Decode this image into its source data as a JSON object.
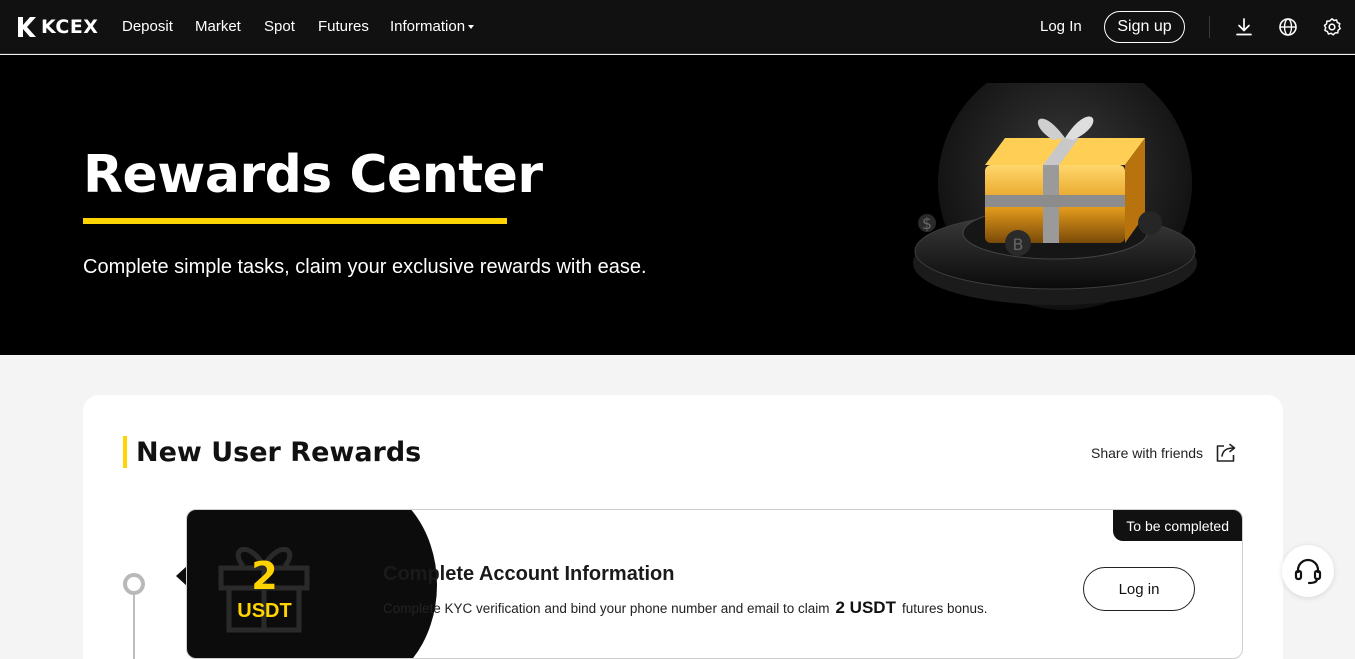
{
  "brand": {
    "name": "KCEX",
    "accent": "#ffd400",
    "dark": "#111112"
  },
  "nav": {
    "items": [
      {
        "label": "Deposit"
      },
      {
        "label": "Market"
      },
      {
        "label": "Spot"
      },
      {
        "label": "Futures"
      },
      {
        "label": "Information",
        "has_dropdown": true
      }
    ],
    "login_label": "Log In",
    "signup_label": "Sign up",
    "icons": [
      "download-icon",
      "globe-icon",
      "gear-icon"
    ]
  },
  "hero": {
    "title": "Rewards Center",
    "subtitle": "Complete simple tasks, claim your exclusive rewards with ease."
  },
  "section": {
    "title": "New User Rewards",
    "share_label": "Share with friends"
  },
  "task": {
    "reward_amount": "2",
    "reward_unit": "USDT",
    "status": "To be completed",
    "title": "Complete Account Information",
    "desc_before": "Complete KYC verification and bind your phone number and email to claim",
    "desc_highlight": "2 USDT",
    "desc_after": "futures bonus.",
    "button_label": "Log in"
  },
  "support": {
    "icon": "headset-icon"
  }
}
